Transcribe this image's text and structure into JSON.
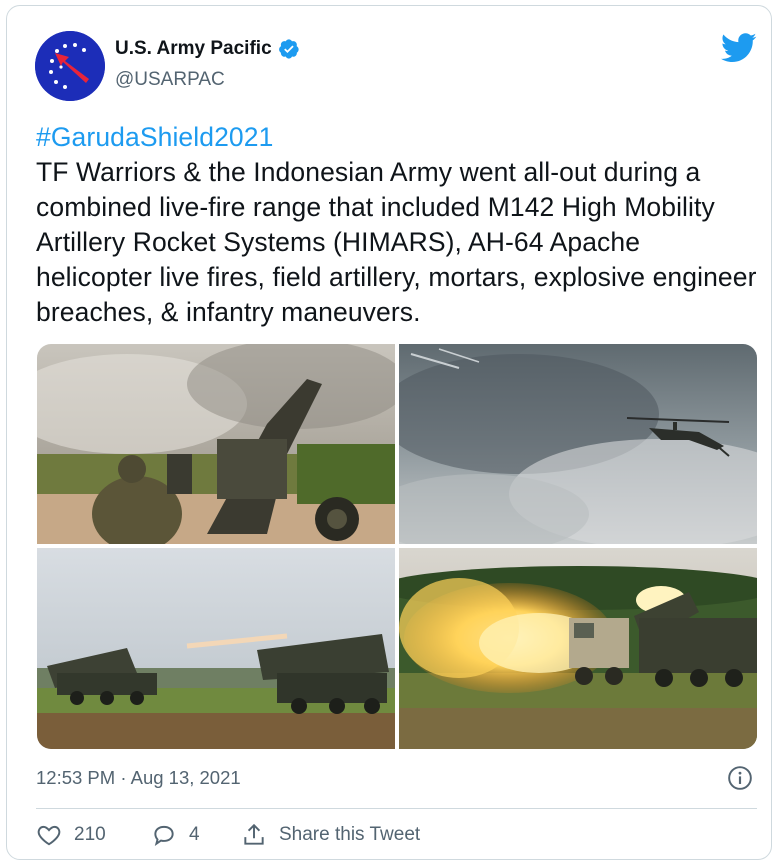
{
  "author": {
    "name": "U.S. Army Pacific",
    "handle": "@USARPAC",
    "avatar_icon": "usarpac-logo",
    "verified_icon": "verified-badge-icon",
    "brand_color": "#1d9bf0"
  },
  "tweet": {
    "hashtag": "#GarudaShield2021",
    "text": "TF Warriors & the Indonesian Army went all-out during a combined live-fire range that included M142 High Mobility Artillery Rocket Systems (HIMARS), AH-64 Apache helicopter live fires, field artillery, mortars, explosive engineer breaches, & infantry maneuvers."
  },
  "media": {
    "photo_icons": [
      "howitzer-photo",
      "apache-helicopter-photo",
      "himars-launchers-photo",
      "himars-firing-photo"
    ]
  },
  "meta": {
    "timestamp": "12:53 PM · Aug 13, 2021"
  },
  "actions": {
    "like_count": "210",
    "reply_count": "4",
    "share_label": "Share this Tweet"
  }
}
